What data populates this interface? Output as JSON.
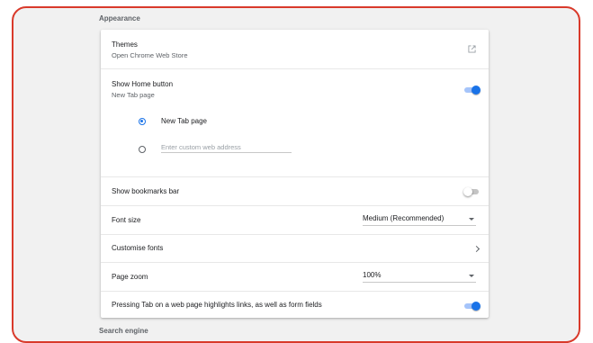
{
  "sections": {
    "appearance_title": "Appearance",
    "search_engine_title": "Search engine"
  },
  "themes": {
    "label": "Themes",
    "sublabel": "Open Chrome Web Store",
    "icon": "open-in-new-icon"
  },
  "home_button": {
    "label": "Show Home button",
    "sublabel": "New Tab page",
    "enabled": true,
    "options": [
      {
        "label": "New Tab page",
        "selected": true
      },
      {
        "placeholder": "Enter custom web address",
        "selected": false
      }
    ]
  },
  "bookmarks_bar": {
    "label": "Show bookmarks bar",
    "enabled": false
  },
  "font_size": {
    "label": "Font size",
    "value": "Medium (Recommended)"
  },
  "customise_fonts": {
    "label": "Customise fonts"
  },
  "page_zoom": {
    "label": "Page zoom",
    "value": "100%"
  },
  "tab_highlight": {
    "label": "Pressing Tab on a web page highlights links, as well as form fields",
    "enabled": true
  },
  "colors": {
    "accent": "#1a73e8",
    "frame_border": "#d93a2b",
    "background": "#f1f1f1"
  }
}
